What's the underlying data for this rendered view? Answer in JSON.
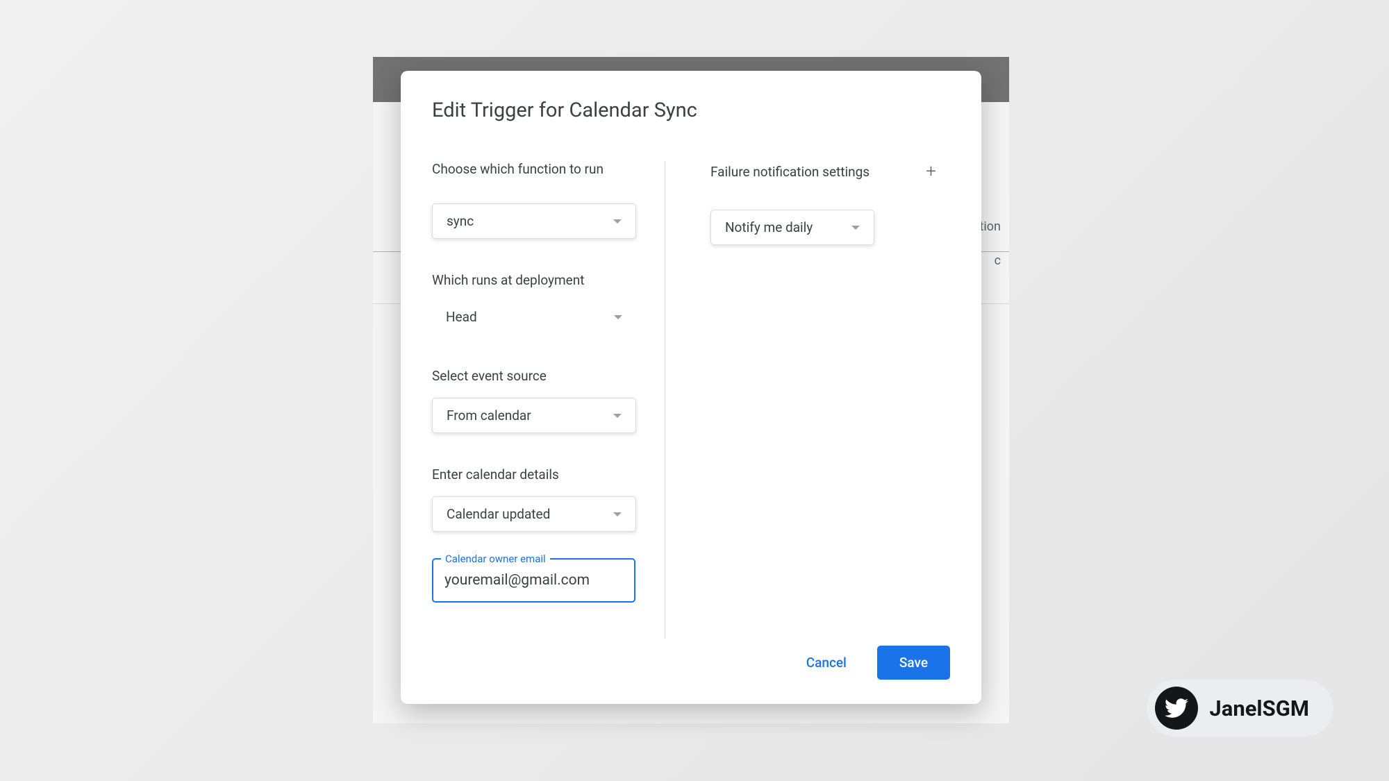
{
  "modal": {
    "title": "Edit Trigger for Calendar Sync",
    "left": {
      "function_label": "Choose which function to run",
      "function_value": "sync",
      "deployment_label": "Which runs at deployment",
      "deployment_value": "Head",
      "event_source_label": "Select event source",
      "event_source_value": "From calendar",
      "calendar_details_label": "Enter calendar details",
      "calendar_details_value": "Calendar updated",
      "email_floating_label": "Calendar owner email",
      "email_value": "youremail@gmail.com"
    },
    "right": {
      "failure_label": "Failure notification settings",
      "failure_value": "Notify me daily"
    },
    "actions": {
      "cancel": "Cancel",
      "save": "Save"
    }
  },
  "backdrop": {
    "text1": "ction",
    "text2": "c"
  },
  "watermark": {
    "handle": "JanelSGM"
  }
}
